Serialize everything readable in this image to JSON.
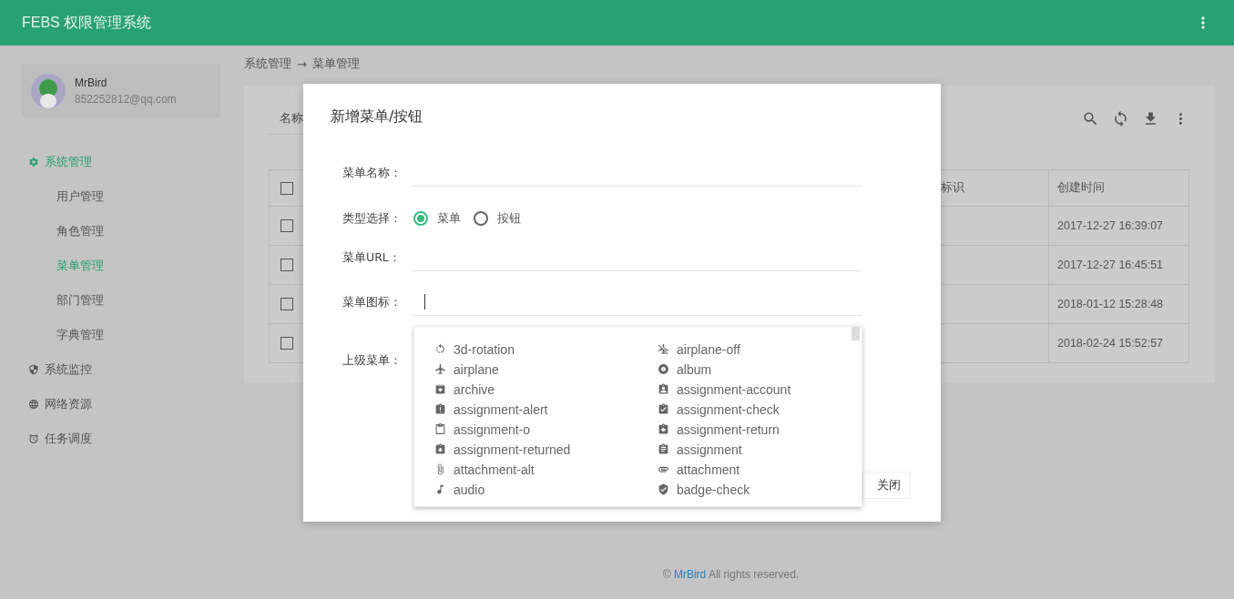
{
  "header": {
    "title": "FEBS 权限管理系统"
  },
  "user": {
    "name": "MrBird",
    "email": "852252812@qq.com"
  },
  "nav": [
    {
      "label": "系统管理",
      "selected": true,
      "children": [
        {
          "label": "用户管理",
          "selected": false
        },
        {
          "label": "角色管理",
          "selected": false
        },
        {
          "label": "菜单管理",
          "selected": true
        },
        {
          "label": "部门管理",
          "selected": false
        },
        {
          "label": "字典管理",
          "selected": false
        }
      ]
    },
    {
      "label": "系统监控",
      "selected": false
    },
    {
      "label": "网络资源",
      "selected": false
    },
    {
      "label": "任务调度",
      "selected": false
    }
  ],
  "breadcrumb": [
    "系统管理",
    "→",
    "菜单管理"
  ],
  "search": {
    "label": "名称"
  },
  "table": {
    "header_checked": false,
    "columns": [
      "标识",
      "创建时间"
    ],
    "rows": [
      {
        "checked": false,
        "created": "2017-12-27 16:39:07"
      },
      {
        "checked": false,
        "created": "2017-12-27 16:45:51"
      },
      {
        "checked": false,
        "created": "2018-01-12 15:28:48"
      },
      {
        "checked": false,
        "created": "2018-02-24 15:52:57"
      }
    ]
  },
  "footer": {
    "prefix": "©",
    "link": "MrBird",
    "suffix": "All rights reserved."
  },
  "modal": {
    "title": "新增菜单/按钮",
    "fields": [
      {
        "kind": "text",
        "label": "菜单名称："
      },
      {
        "kind": "radio",
        "label": "类型选择：",
        "options": [
          {
            "label": "菜单",
            "selected": true
          },
          {
            "label": "按钮",
            "selected": false
          }
        ]
      },
      {
        "kind": "text",
        "label": "菜单URL："
      },
      {
        "kind": "text",
        "label": "菜单图标：",
        "focused": true
      },
      {
        "kind": "tree",
        "label": "上级菜单："
      }
    ],
    "icon_list": [
      "3d-rotation",
      "airplane-off",
      "airplane",
      "album",
      "archive",
      "assignment-account",
      "assignment-alert",
      "assignment-check",
      "assignment-o",
      "assignment-return",
      "assignment-returned",
      "assignment",
      "attachment-alt",
      "attachment",
      "audio",
      "badge-check"
    ],
    "close_button": "关闭"
  }
}
